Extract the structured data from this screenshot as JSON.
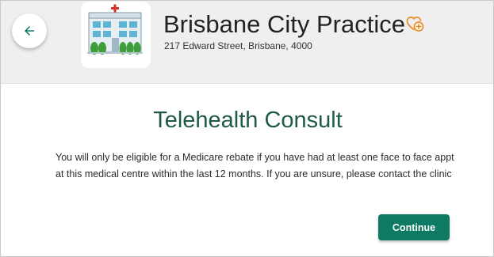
{
  "header": {
    "practice_name": "Brisbane City Practice",
    "practice_address": "217 Edward Street, Brisbane, 4000",
    "back_icon": "arrow-left-icon",
    "logo_icon": "hospital-building-icon",
    "favorite_icon": "heart-plus-icon"
  },
  "main": {
    "title": "Telehealth Consult",
    "message": "You will only be eligible for a Medicare rebate if you have had at least one face to face appt at this medical centre within the last 12 months. If you are unsure, please contact the clinic",
    "continue_label": "Continue"
  },
  "colors": {
    "header_bg": "#efefef",
    "accent": "#0e7a64",
    "title": "#1e5a45",
    "favorite": "#e8912c"
  }
}
